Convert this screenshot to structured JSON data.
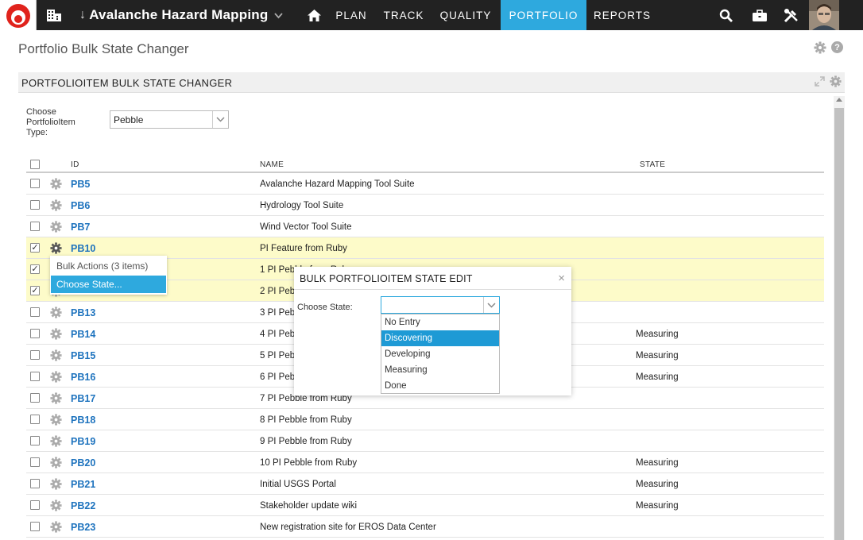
{
  "topbar": {
    "project": "Avalanche Hazard Mapping",
    "nav": [
      {
        "label": "PLAN"
      },
      {
        "label": "TRACK"
      },
      {
        "label": "QUALITY"
      },
      {
        "label": "PORTFOLIO",
        "active": true
      },
      {
        "label": "REPORTS"
      }
    ],
    "icons": [
      "home-icon",
      "search-icon",
      "briefcase-icon",
      "tools-icon"
    ],
    "accent": "#2ea9de"
  },
  "page": {
    "title": "Portfolio Bulk State Changer",
    "panel_title": "PORTFOLIOITEM BULK STATE CHANGER"
  },
  "filter": {
    "label": "Choose PortfolioItem Type:",
    "value": "Pebble"
  },
  "grid": {
    "headers": {
      "id": "ID",
      "name": "NAME",
      "state": "STATE"
    },
    "rows": [
      {
        "id": "PB5",
        "name": "Avalanche Hazard Mapping Tool Suite",
        "state": "",
        "checked": false
      },
      {
        "id": "PB6",
        "name": "Hydrology Tool Suite",
        "state": "",
        "checked": false
      },
      {
        "id": "PB7",
        "name": "Wind Vector Tool Suite",
        "state": "",
        "checked": false
      },
      {
        "id": "PB10",
        "name": "PI Feature from Ruby",
        "state": "",
        "checked": true
      },
      {
        "id": "PB11",
        "name": "1 PI Pebble from Ruby",
        "state": "",
        "checked": true
      },
      {
        "id": "PB12",
        "name": "2 PI Pebble from Ruby",
        "state": "",
        "checked": true
      },
      {
        "id": "PB13",
        "name": "3 PI Pebble from Ruby",
        "state": "",
        "checked": false
      },
      {
        "id": "PB14",
        "name": "4 PI Pebble from Ruby",
        "state": "Measuring",
        "checked": false
      },
      {
        "id": "PB15",
        "name": "5 PI Pebble from Ruby",
        "state": "Measuring",
        "checked": false
      },
      {
        "id": "PB16",
        "name": "6 PI Pebbble from Ruby",
        "state": "Measuring",
        "checked": false
      },
      {
        "id": "PB17",
        "name": "7 PI Pebble from Ruby",
        "state": "",
        "checked": false
      },
      {
        "id": "PB18",
        "name": "8 PI Pebble from Ruby",
        "state": "",
        "checked": false
      },
      {
        "id": "PB19",
        "name": "9 PI Pebble from Ruby",
        "state": "",
        "checked": false
      },
      {
        "id": "PB20",
        "name": "10 PI Pebble from Ruby",
        "state": "Measuring",
        "checked": false
      },
      {
        "id": "PB21",
        "name": "Initial USGS Portal",
        "state": "Measuring",
        "checked": false
      },
      {
        "id": "PB22",
        "name": "Stakeholder update wiki",
        "state": "Measuring",
        "checked": false
      },
      {
        "id": "PB23",
        "name": "New registration site for EROS Data Center",
        "state": "",
        "checked": false
      }
    ]
  },
  "context_menu": {
    "title": "Bulk Actions (3 items)",
    "item": "Choose State..."
  },
  "modal": {
    "title": "BULK PORTFOLIOITEM STATE EDIT",
    "label": "Choose State:",
    "value": "",
    "options": [
      "No Entry",
      "Discovering",
      "Developing",
      "Measuring",
      "Done"
    ],
    "highlighted": "Discovering"
  }
}
